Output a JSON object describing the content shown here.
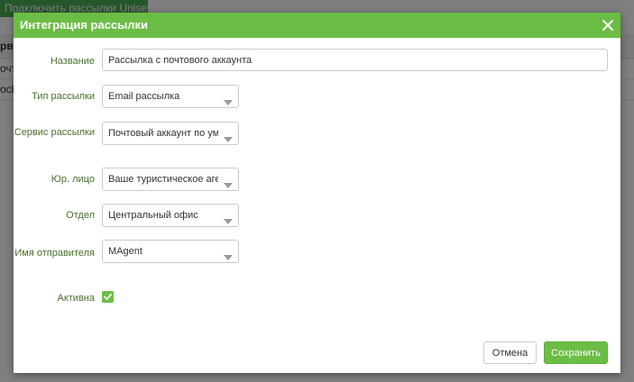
{
  "background": {
    "connect_button": "Подключить рассылки Unisender",
    "table_header": "рви",
    "rows": [
      "очто",
      "och"
    ]
  },
  "modal": {
    "title": "Интеграция рассылки",
    "close_icon": "close-icon",
    "fields": {
      "name": {
        "label": "Название",
        "value": "Рассылка с почтового аккаунта"
      },
      "type": {
        "label": "Тип рассылки",
        "value": "Email рассылка"
      },
      "service": {
        "label": "Сервис рассылки",
        "value": "Почтовый аккаунт по умолчанию"
      },
      "legal_entity": {
        "label": "Юр. лицо",
        "value": "Ваше туристическое агентство"
      },
      "department": {
        "label": "Отдел",
        "value": "Центральный офис"
      },
      "sender": {
        "label": "Имя отправителя",
        "value": "MAgent"
      },
      "active": {
        "label": "Активна",
        "checked": true
      }
    },
    "buttons": {
      "cancel": "Отмена",
      "save": "Сохранить"
    }
  },
  "colors": {
    "accent": "#6cbd45",
    "label": "#4b6f2e"
  }
}
